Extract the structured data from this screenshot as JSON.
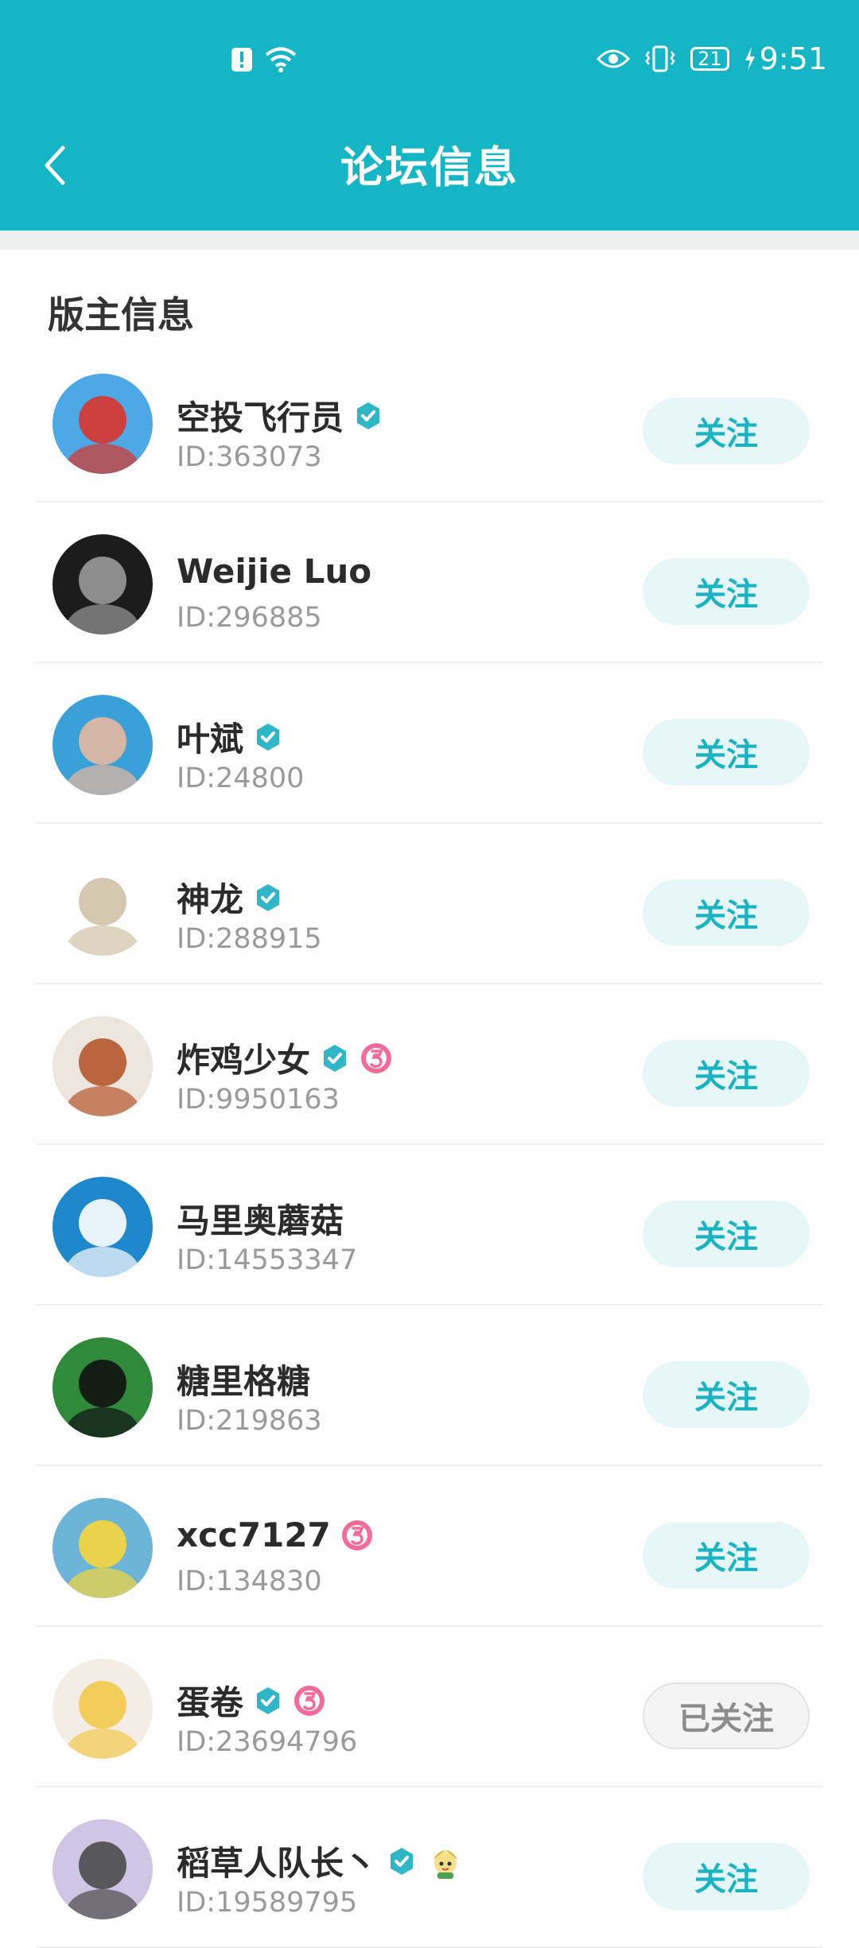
{
  "status_bar": {
    "time": "9:51",
    "battery": "21",
    "icons": [
      "alert-icon",
      "wifi-icon",
      "eye-icon",
      "vibrate-icon",
      "battery-icon",
      "charging-icon"
    ]
  },
  "header": {
    "title": "论坛信息",
    "back_icon": "back-chevron-icon",
    "color": "#14b5c4"
  },
  "section": {
    "title": "版主信息"
  },
  "moderators": [
    {
      "name": "空投飞行员",
      "id": "ID:363073",
      "button": "关注",
      "verified": true,
      "level": false,
      "extra": false,
      "followed": false,
      "avatar_colors": [
        "#4da9e6",
        "#d9332b"
      ]
    },
    {
      "name": "Weijie  Luo",
      "id": "ID:296885",
      "button": "关注",
      "verified": false,
      "level": false,
      "extra": false,
      "followed": false,
      "avatar_colors": [
        "#1c1c1c",
        "#9a9a9a"
      ]
    },
    {
      "name": "叶斌",
      "id": "ID:24800",
      "button": "关注",
      "verified": true,
      "level": false,
      "extra": false,
      "followed": false,
      "avatar_colors": [
        "#3aa0d8",
        "#e7b7a0"
      ]
    },
    {
      "name": "神龙",
      "id": "ID:288915",
      "button": "关注",
      "verified": true,
      "level": false,
      "extra": false,
      "followed": false,
      "avatar_colors": [
        "#ffffff",
        "#cfc2a8"
      ]
    },
    {
      "name": "炸鸡少女",
      "id": "ID:9950163",
      "button": "关注",
      "verified": true,
      "level": true,
      "extra": false,
      "followed": false,
      "avatar_colors": [
        "#ece6de",
        "#b5562c"
      ]
    },
    {
      "name": "马里奥蘑菇",
      "id": "ID:14553347",
      "button": "关注",
      "verified": false,
      "level": false,
      "extra": false,
      "followed": false,
      "avatar_colors": [
        "#1e88cc",
        "#ffffff"
      ]
    },
    {
      "name": "糖里格糖",
      "id": "ID:219863",
      "button": "关注",
      "verified": false,
      "level": false,
      "extra": false,
      "followed": false,
      "avatar_colors": [
        "#2f8b3a",
        "#111111"
      ]
    },
    {
      "name": "xcc7127",
      "id": "ID:134830",
      "button": "关注",
      "verified": false,
      "level": true,
      "extra": false,
      "followed": false,
      "avatar_colors": [
        "#6db5d8",
        "#f5d63c"
      ]
    },
    {
      "name": "蛋卷",
      "id": "ID:23694796",
      "button": "已关注",
      "verified": true,
      "level": true,
      "extra": false,
      "followed": true,
      "avatar_colors": [
        "#f3ede6",
        "#f2c94c"
      ]
    },
    {
      "name": "稻草人队长丶",
      "id": "ID:19589795",
      "button": "关注",
      "verified": true,
      "level": false,
      "extra": true,
      "followed": false,
      "avatar_colors": [
        "#cfc6e6",
        "#4a4a4a"
      ]
    }
  ]
}
